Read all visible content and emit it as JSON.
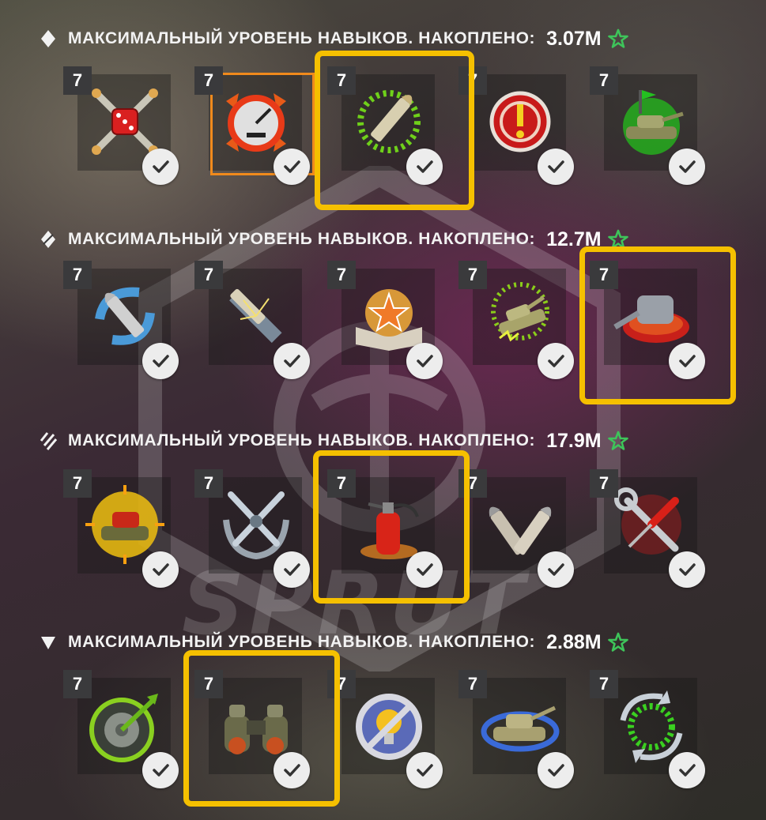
{
  "tiers": [
    {
      "icon": "diamond-icon",
      "label": "МАКСИМАЛЬНЫЙ УРОВЕНЬ НАВЫКОВ. НАКОПЛЕНО:",
      "value": "3.07M",
      "skills": [
        {
          "level": "7",
          "icon": "dice-shells-icon",
          "checked": true
        },
        {
          "level": "7",
          "icon": "speedometer-icon",
          "checked": true
        },
        {
          "level": "7",
          "icon": "glowing-shell-icon",
          "checked": true
        },
        {
          "level": "7",
          "icon": "alert-target-icon",
          "checked": true
        },
        {
          "level": "7",
          "icon": "tank-flag-icon",
          "checked": true
        }
      ]
    },
    {
      "icon": "split-diamond-icon",
      "label": "МАКСИМАЛЬНЫЙ УРОВЕНЬ НАВЫКОВ. НАКОПЛЕНО:",
      "value": "12.7M",
      "skills": [
        {
          "level": "7",
          "icon": "curved-shell-icon",
          "checked": true
        },
        {
          "level": "7",
          "icon": "shell-armor-impact-icon",
          "checked": true
        },
        {
          "level": "7",
          "icon": "star-book-icon",
          "checked": true
        },
        {
          "level": "7",
          "icon": "electric-tank-icon",
          "checked": true
        },
        {
          "level": "7",
          "icon": "turret-gear-icon",
          "checked": true
        }
      ]
    },
    {
      "icon": "triple-stripe-icon",
      "label": "МАКСИМАЛЬНЫЙ УРОВЕНЬ НАВЫКОВ. НАКОПЛЕНО:",
      "value": "17.9M",
      "skills": [
        {
          "level": "7",
          "icon": "sunburst-tank-icon",
          "checked": true
        },
        {
          "level": "7",
          "icon": "crossed-swords-wreath-icon",
          "checked": true
        },
        {
          "level": "7",
          "icon": "fire-extinguisher-icon",
          "checked": true
        },
        {
          "level": "7",
          "icon": "double-shells-icon",
          "checked": true
        },
        {
          "level": "7",
          "icon": "wrench-screwdriver-icon",
          "checked": true
        }
      ]
    },
    {
      "icon": "triangle-down-icon",
      "label": "МАКСИМАЛЬНЫЙ УРОВЕНЬ НАВЫКОВ. НАКОПЛЕНО:",
      "value": "2.88M",
      "skills": [
        {
          "level": "7",
          "icon": "wheel-arrow-icon",
          "checked": true
        },
        {
          "level": "7",
          "icon": "binoculars-icon",
          "checked": true
        },
        {
          "level": "7",
          "icon": "no-lightbulb-icon",
          "checked": true
        },
        {
          "level": "7",
          "icon": "tank-rotate-icon",
          "checked": true
        },
        {
          "level": "7",
          "icon": "refresh-circle-icon",
          "checked": true
        }
      ]
    }
  ],
  "colors": {
    "highlight": "#f5c000",
    "star": "#3ec45a",
    "selected_frame": "#f08a1c"
  },
  "watermark": "SPRUT"
}
